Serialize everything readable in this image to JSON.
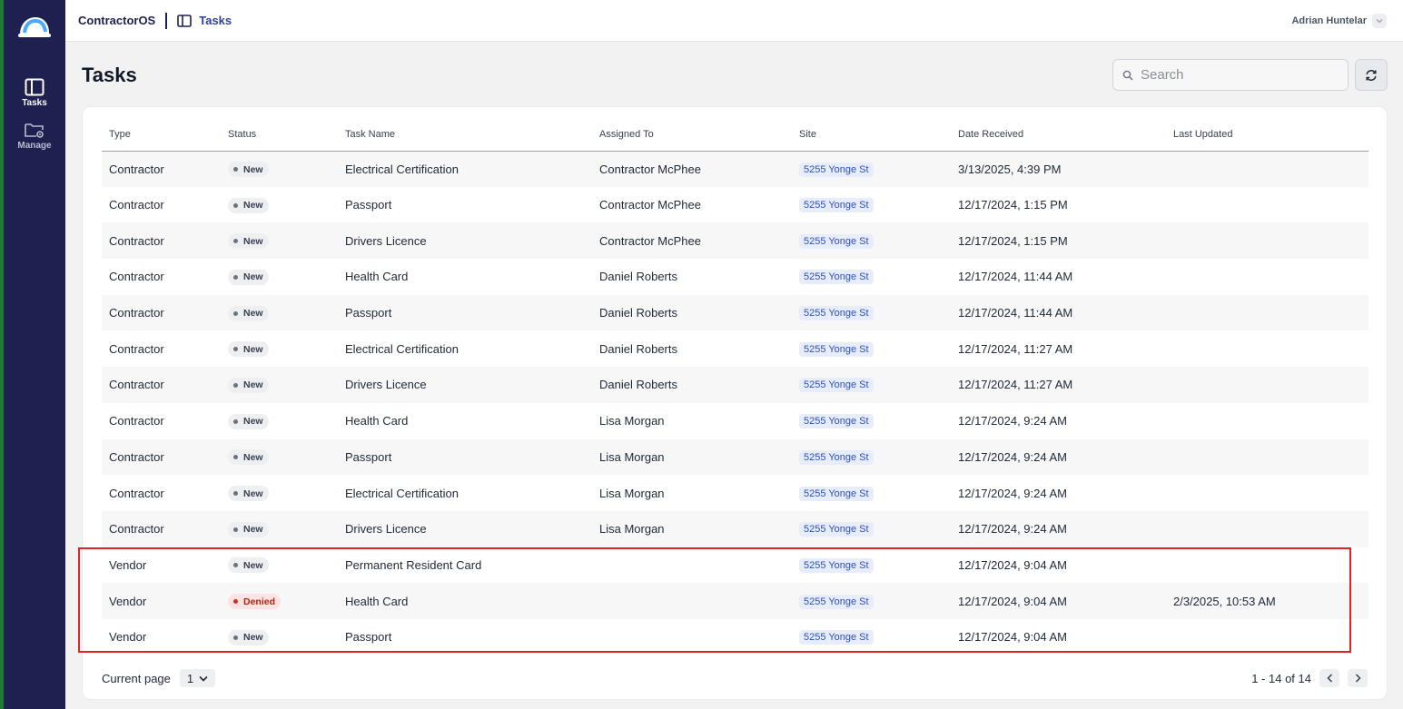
{
  "app": {
    "name": "ContractorOS",
    "breadcrumb": "Tasks",
    "user_name": "Adrian Huntelar"
  },
  "sidebar": {
    "items": [
      {
        "label": "Tasks",
        "icon": "sidebar-panel-icon",
        "active": true
      },
      {
        "label": "Manage",
        "icon": "folder-settings-icon",
        "active": false
      }
    ]
  },
  "page": {
    "title": "Tasks"
  },
  "search": {
    "placeholder": "Search",
    "value": ""
  },
  "table": {
    "columns": [
      "Type",
      "Status",
      "Task Name",
      "Assigned To",
      "Site",
      "Date Received",
      "Last Updated"
    ],
    "rows": [
      {
        "type": "Contractor",
        "status": "New",
        "task": "Electrical Certification",
        "assigned": "Contractor McPhee",
        "site": "5255 Yonge St",
        "received": "3/13/2025, 4:39 PM",
        "updated": ""
      },
      {
        "type": "Contractor",
        "status": "New",
        "task": "Passport",
        "assigned": "Contractor McPhee",
        "site": "5255 Yonge St",
        "received": "12/17/2024, 1:15 PM",
        "updated": ""
      },
      {
        "type": "Contractor",
        "status": "New",
        "task": "Drivers Licence",
        "assigned": "Contractor McPhee",
        "site": "5255 Yonge St",
        "received": "12/17/2024, 1:15 PM",
        "updated": ""
      },
      {
        "type": "Contractor",
        "status": "New",
        "task": "Health Card",
        "assigned": "Daniel Roberts",
        "site": "5255 Yonge St",
        "received": "12/17/2024, 11:44 AM",
        "updated": ""
      },
      {
        "type": "Contractor",
        "status": "New",
        "task": "Passport",
        "assigned": "Daniel Roberts",
        "site": "5255 Yonge St",
        "received": "12/17/2024, 11:44 AM",
        "updated": ""
      },
      {
        "type": "Contractor",
        "status": "New",
        "task": "Electrical Certification",
        "assigned": "Daniel Roberts",
        "site": "5255 Yonge St",
        "received": "12/17/2024, 11:27 AM",
        "updated": ""
      },
      {
        "type": "Contractor",
        "status": "New",
        "task": "Drivers Licence",
        "assigned": "Daniel Roberts",
        "site": "5255 Yonge St",
        "received": "12/17/2024, 11:27 AM",
        "updated": ""
      },
      {
        "type": "Contractor",
        "status": "New",
        "task": "Health Card",
        "assigned": "Lisa Morgan",
        "site": "5255 Yonge St",
        "received": "12/17/2024, 9:24 AM",
        "updated": ""
      },
      {
        "type": "Contractor",
        "status": "New",
        "task": "Passport",
        "assigned": "Lisa Morgan",
        "site": "5255 Yonge St",
        "received": "12/17/2024, 9:24 AM",
        "updated": ""
      },
      {
        "type": "Contractor",
        "status": "New",
        "task": "Electrical Certification",
        "assigned": "Lisa Morgan",
        "site": "5255 Yonge St",
        "received": "12/17/2024, 9:24 AM",
        "updated": ""
      },
      {
        "type": "Contractor",
        "status": "New",
        "task": "Drivers Licence",
        "assigned": "Lisa Morgan",
        "site": "5255 Yonge St",
        "received": "12/17/2024, 9:24 AM",
        "updated": ""
      },
      {
        "type": "Vendor",
        "status": "New",
        "task": "Permanent Resident Card",
        "assigned": "",
        "site": "5255 Yonge St",
        "received": "12/17/2024, 9:04 AM",
        "updated": ""
      },
      {
        "type": "Vendor",
        "status": "Denied",
        "task": "Health Card",
        "assigned": "",
        "site": "5255 Yonge St",
        "received": "12/17/2024, 9:04 AM",
        "updated": "2/3/2025, 10:53 AM"
      },
      {
        "type": "Vendor",
        "status": "New",
        "task": "Passport",
        "assigned": "",
        "site": "5255 Yonge St",
        "received": "12/17/2024, 9:04 AM",
        "updated": ""
      }
    ]
  },
  "pagination": {
    "label": "Current page",
    "current": "1",
    "range": "1 - 14 of 14"
  },
  "colors": {
    "sidebar": "#1e2150",
    "accent": "#2b3fa8",
    "highlight": "#e02424",
    "denied": "#b42318"
  }
}
